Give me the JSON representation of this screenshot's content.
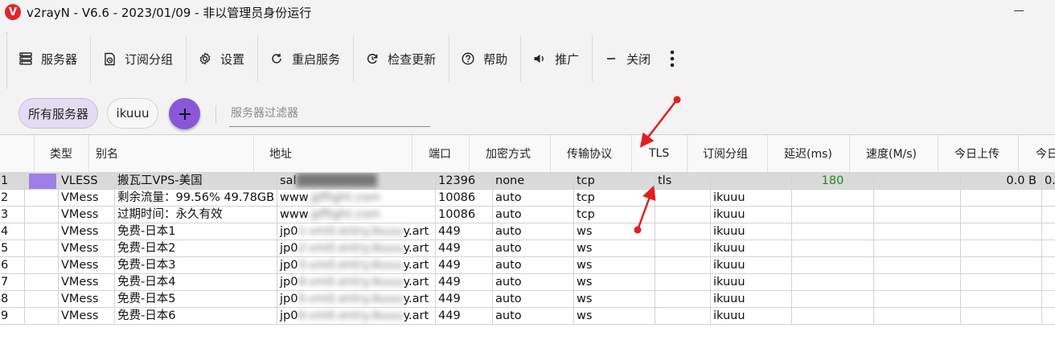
{
  "window": {
    "title": "v2rayN - V6.6 - 2023/01/09 - 非以管理员身份运行",
    "logo_letter": "V"
  },
  "toolbar": {
    "items": [
      {
        "label": "服务器",
        "icon": "server-icon"
      },
      {
        "label": "订阅分组",
        "icon": "subscription-icon"
      },
      {
        "label": "设置",
        "icon": "gear-icon"
      },
      {
        "label": "重启服务",
        "icon": "restart-icon"
      },
      {
        "label": "检查更新",
        "icon": "update-icon"
      },
      {
        "label": "帮助",
        "icon": "help-icon"
      },
      {
        "label": "推广",
        "icon": "speaker-icon"
      },
      {
        "label": "关闭",
        "icon": "minus-icon"
      }
    ],
    "more_icon": "more-vertical-icon"
  },
  "filters": {
    "chips": [
      "所有服务器",
      "ikuuu"
    ],
    "active_chip": "所有服务器",
    "add_icon": "plus-icon",
    "filter_placeholder": "服务器过滤器"
  },
  "table": {
    "headers": [
      "类型",
      "别名",
      "地址",
      "端口",
      "加密方式",
      "传输协议",
      "TLS",
      "订阅分组",
      "延迟(ms)",
      "速度(M/s)",
      "今日上传",
      "今日"
    ],
    "rows": [
      {
        "idx": "1",
        "type": "VLESS",
        "alias": "搬瓦工VPS-美国",
        "address": "sal█████████",
        "port": "12396",
        "security": "none",
        "network": "tcp",
        "tls": "tls",
        "sub": "",
        "delay": "180",
        "speed": "",
        "up": "0.0 B",
        "down": "0."
      },
      {
        "idx": "2",
        "type": "VMess",
        "alias": "剩余流量：99.56% 49.78GB",
        "address": "www.glflight.com",
        "port": "10086",
        "security": "auto",
        "network": "tcp",
        "tls": "",
        "sub": "ikuuu",
        "delay": "",
        "speed": "",
        "up": "",
        "down": ""
      },
      {
        "idx": "3",
        "type": "VMess",
        "alias": "过期时间：永久有效",
        "address": "www.glflight.com",
        "port": "10086",
        "security": "auto",
        "network": "tcp",
        "tls": "",
        "sub": "ikuuu",
        "delay": "",
        "speed": "",
        "up": "",
        "down": ""
      },
      {
        "idx": "4",
        "type": "VMess",
        "alias": "免费-日本1",
        "address": "jp01-vm0.entry.ikuuuy.art",
        "port": "449",
        "security": "auto",
        "network": "ws",
        "tls": "",
        "sub": "ikuuu",
        "delay": "",
        "speed": "",
        "up": "",
        "down": ""
      },
      {
        "idx": "5",
        "type": "VMess",
        "alias": "免费-日本2",
        "address": "jp02-vm0.entry.ikuuuy.art",
        "port": "449",
        "security": "auto",
        "network": "ws",
        "tls": "",
        "sub": "ikuuu",
        "delay": "",
        "speed": "",
        "up": "",
        "down": ""
      },
      {
        "idx": "6",
        "type": "VMess",
        "alias": "免费-日本3",
        "address": "jp03-vm0.entry.ikuuuy.art",
        "port": "449",
        "security": "auto",
        "network": "ws",
        "tls": "",
        "sub": "ikuuu",
        "delay": "",
        "speed": "",
        "up": "",
        "down": ""
      },
      {
        "idx": "7",
        "type": "VMess",
        "alias": "免费-日本4",
        "address": "jp04-vm0.entry.ikuuuy.art",
        "port": "449",
        "security": "auto",
        "network": "ws",
        "tls": "",
        "sub": "ikuuu",
        "delay": "",
        "speed": "",
        "up": "",
        "down": ""
      },
      {
        "idx": "8",
        "type": "VMess",
        "alias": "免费-日本5",
        "address": "jp05-vm0.entry.ikuuuy.art",
        "port": "449",
        "security": "auto",
        "network": "ws",
        "tls": "",
        "sub": "ikuuu",
        "delay": "",
        "speed": "",
        "up": "",
        "down": ""
      },
      {
        "idx": "9",
        "type": "VMess",
        "alias": "免费-日本6",
        "address": "jp06-vm0.entry.ikuuuy.art",
        "port": "449",
        "security": "auto",
        "network": "ws",
        "tls": "",
        "sub": "ikuuu",
        "delay": "",
        "speed": "",
        "up": "",
        "down": ""
      }
    ],
    "selected_row": 0
  },
  "colors": {
    "accent": "#8b57d8",
    "selected_swatch": "#a07ee8",
    "annotation_arrow": "#e02020",
    "delay_good": "#1e8a1e"
  }
}
